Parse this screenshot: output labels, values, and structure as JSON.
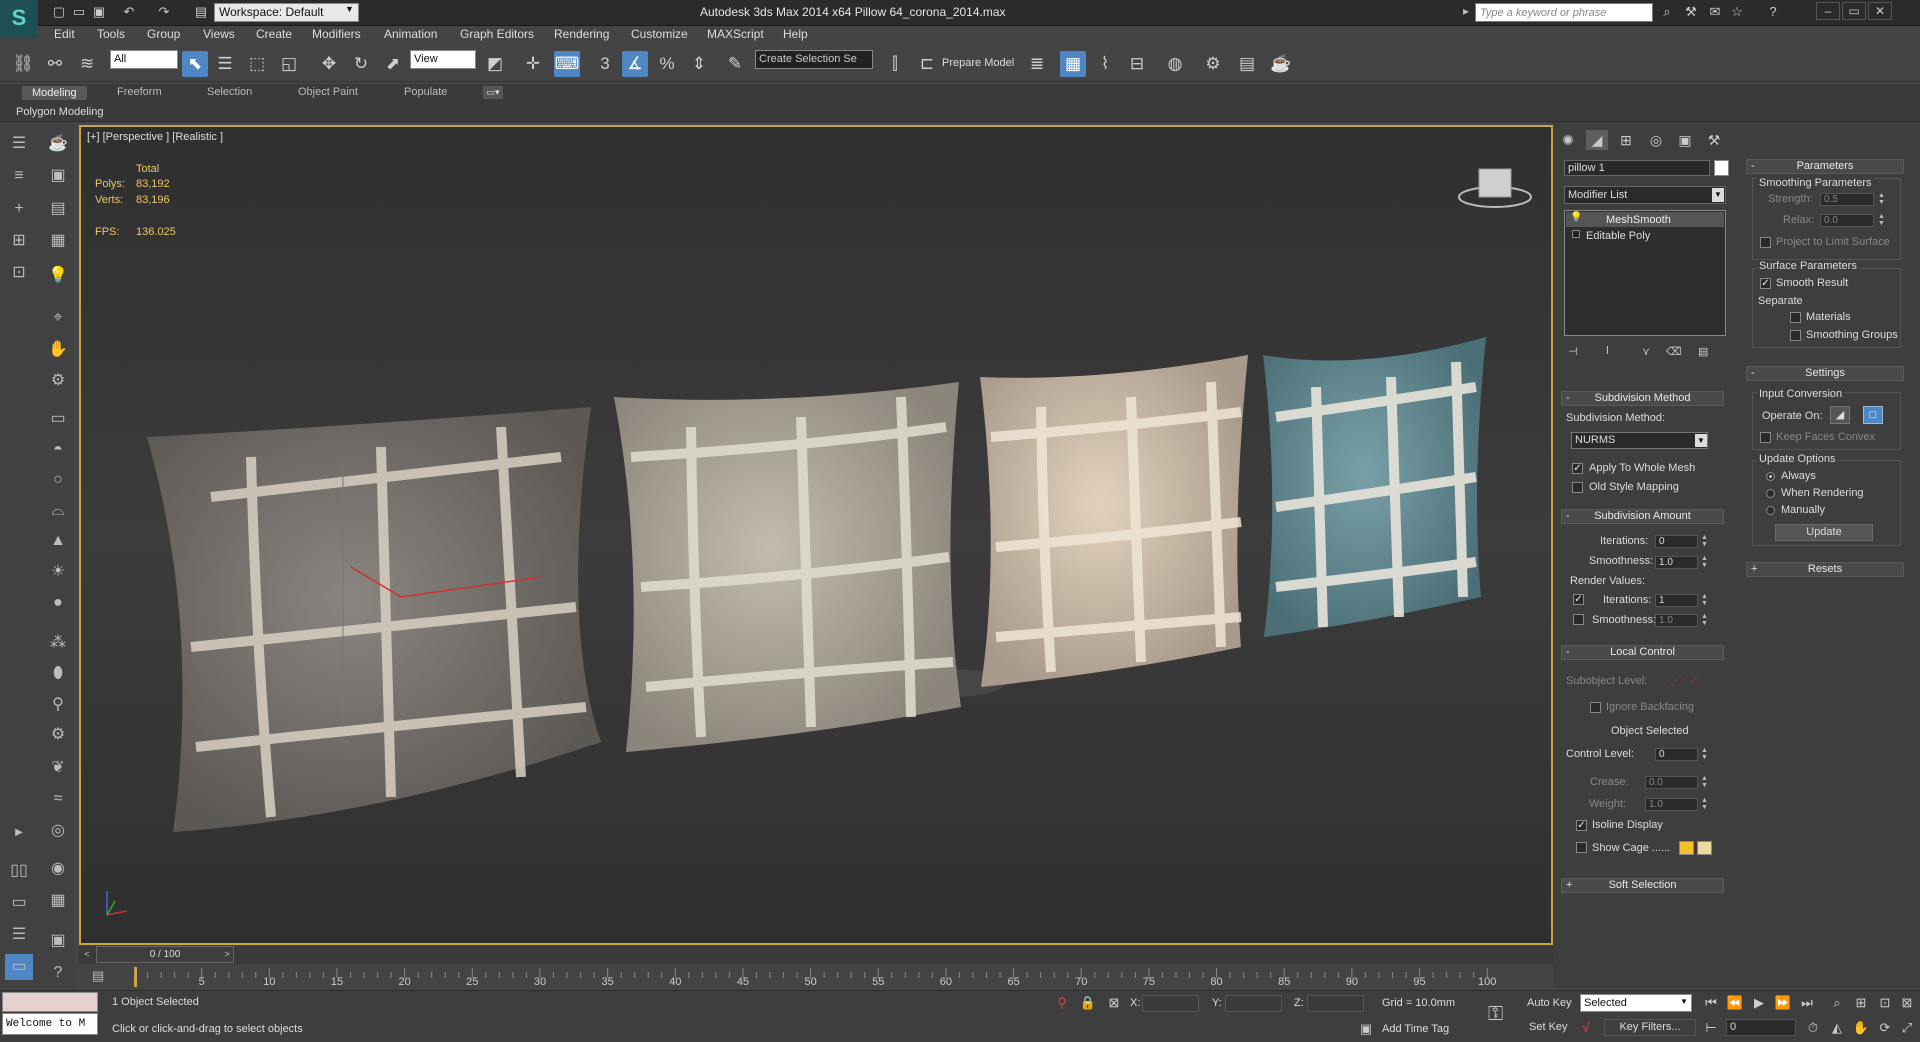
{
  "title_bar": {
    "workspace": "Workspace: Default",
    "app_title": "Autodesk 3ds Max  2014 x64      Pillow 64_corona_2014.max",
    "search_placeholder": "Type a keyword or phrase"
  },
  "menu": [
    "Edit",
    "Tools",
    "Group",
    "Views",
    "Create",
    "Modifiers",
    "Animation",
    "Graph Editors",
    "Rendering",
    "Customize",
    "MAXScript",
    "Help"
  ],
  "toolbar": {
    "selection_filter": "All",
    "ref_coord": "View",
    "snap_3": "3",
    "named_selection": "Create Selection Se",
    "prepare_model": "Prepare Model"
  },
  "ribbon": {
    "tabs": [
      "Modeling",
      "Freeform",
      "Selection",
      "Object Paint",
      "Populate"
    ],
    "active": "Modeling",
    "subpanel": "Polygon Modeling"
  },
  "viewport": {
    "label": "[+] [Perspective ] [Realistic ]",
    "stats_total": "Total",
    "polys_label": "Polys:",
    "polys_value": "83,192",
    "verts_label": "Verts:",
    "verts_value": "83,196",
    "fps_label": "FPS:",
    "fps_value": "136.025"
  },
  "command_panel": {
    "object_name": "pillow 1",
    "modifier_list": "Modifier List",
    "stack": [
      "MeshSmooth",
      "Editable Poly"
    ],
    "subdivision_method": {
      "header": "Subdivision Method",
      "label": "Subdivision Method:",
      "value": "NURMS",
      "apply_whole_mesh": "Apply To Whole Mesh",
      "old_style_mapping": "Old Style Mapping"
    },
    "subdivision_amount": {
      "header": "Subdivision Amount",
      "iterations_label": "Iterations:",
      "iterations": "0",
      "smoothness_label": "Smoothness:",
      "smoothness": "1.0",
      "render_values": "Render Values:",
      "r_iterations_label": "Iterations:",
      "r_iterations": "1",
      "r_smoothness_label": "Smoothness:",
      "r_smoothness": "1.0"
    },
    "local_control": {
      "header": "Local Control",
      "subobject_level": "Subobject Level:",
      "ignore_backfacing": "Ignore Backfacing",
      "object_selected": "Object Selected",
      "control_level_label": "Control Level:",
      "control_level": "0",
      "crease_label": "Crease:",
      "crease": "0.0",
      "weight_label": "Weight:",
      "weight": "1.0",
      "isoline_display": "Isoline Display",
      "show_cage": "Show Cage ......"
    },
    "soft_selection": "Soft Selection",
    "parameters": {
      "header": "Parameters",
      "smoothing_parameters": "Smoothing Parameters",
      "strength_label": "Strength:",
      "strength": "0.5",
      "relax_label": "Relax:",
      "relax": "0.0",
      "project_limit": "Project to Limit Surface",
      "surface_parameters": "Surface Parameters",
      "smooth_result": "Smooth Result",
      "separate": "Separate",
      "materials": "Materials",
      "smoothing_groups": "Smoothing Groups"
    },
    "settings": {
      "header": "Settings",
      "input_conversion": "Input Conversion",
      "operate_on": "Operate On:",
      "keep_faces_convex": "Keep Faces Convex",
      "update_options": "Update Options",
      "always": "Always",
      "when_rendering": "When Rendering",
      "manually": "Manually",
      "update": "Update"
    },
    "resets": "Resets"
  },
  "timeline": {
    "frame": "0 / 100",
    "ticks": [
      "5",
      "10",
      "15",
      "20",
      "25",
      "30",
      "35",
      "40",
      "45",
      "50",
      "55",
      "60",
      "65",
      "70",
      "75",
      "80",
      "85",
      "90",
      "95",
      "100"
    ]
  },
  "status": {
    "listener": "Welcome to M",
    "selected": "1 Object Selected",
    "prompt": "Click or click-and-drag to select objects",
    "x_label": "X:",
    "y_label": "Y:",
    "z_label": "Z:",
    "grid": "Grid = 10.0mm",
    "add_time_tag": "Add Time Tag",
    "auto_key": "Auto Key",
    "set_key": "Set Key",
    "selected_dropdown": "Selected",
    "key_filters": "Key Filters...",
    "current_frame": "0"
  },
  "colors": {
    "accent_blue": "#4f87c4",
    "viewport_border": "#c8a243",
    "stats": "#e8c86a",
    "cage_color_1": "#f2c12e",
    "cage_color_2": "#e9dc9a"
  }
}
